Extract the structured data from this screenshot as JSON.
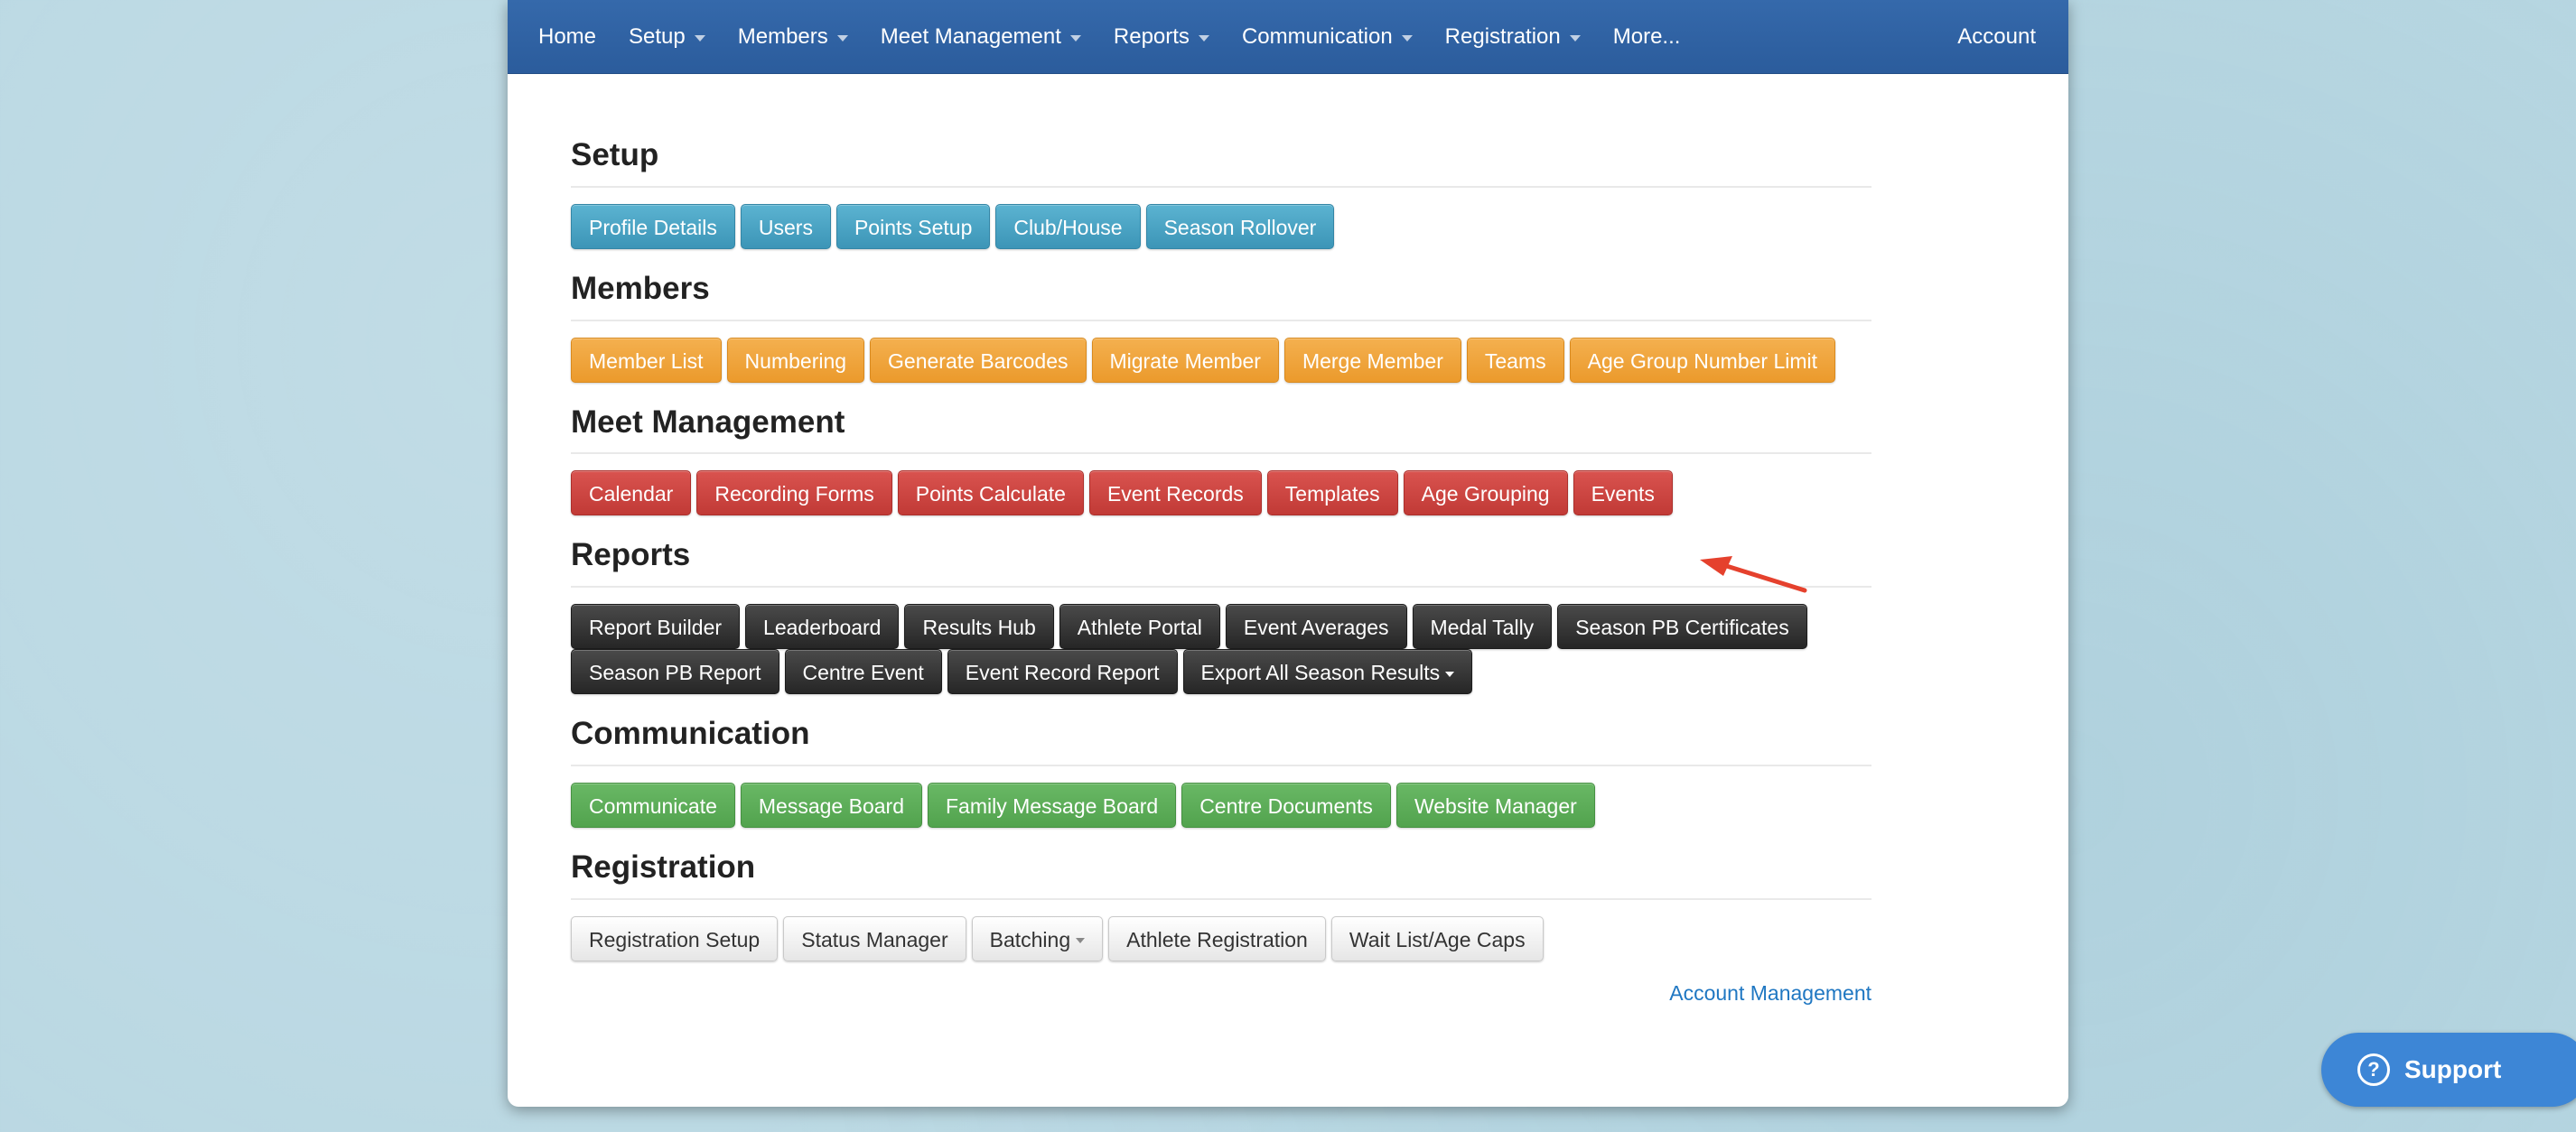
{
  "nav": {
    "items": [
      {
        "label": "Home",
        "dropdown": false
      },
      {
        "label": "Setup",
        "dropdown": true
      },
      {
        "label": "Members",
        "dropdown": true
      },
      {
        "label": "Meet Management",
        "dropdown": true
      },
      {
        "label": "Reports",
        "dropdown": true
      },
      {
        "label": "Communication",
        "dropdown": true
      },
      {
        "label": "Registration",
        "dropdown": true
      },
      {
        "label": "More...",
        "dropdown": false
      }
    ],
    "account": "Account"
  },
  "sections": {
    "setup": {
      "title": "Setup",
      "buttons": [
        "Profile Details",
        "Users",
        "Points Setup",
        "Club/House",
        "Season Rollover"
      ]
    },
    "members": {
      "title": "Members",
      "buttons": [
        "Member List",
        "Numbering",
        "Generate Barcodes",
        "Migrate Member",
        "Merge Member",
        "Teams",
        "Age Group Number Limit"
      ]
    },
    "meet": {
      "title": "Meet Management",
      "buttons": [
        "Calendar",
        "Recording Forms",
        "Points Calculate",
        "Event Records",
        "Templates",
        "Age Grouping",
        "Events"
      ]
    },
    "reports": {
      "title": "Reports",
      "row1": [
        "Report Builder",
        "Leaderboard",
        "Results Hub",
        "Athlete Portal",
        "Event Averages",
        "Medal Tally",
        "Season PB Certificates"
      ],
      "row2": [
        "Season PB Report",
        "Centre Event",
        "Event Record Report",
        "Export All Season Results"
      ]
    },
    "communication": {
      "title": "Communication",
      "buttons": [
        "Communicate",
        "Message Board",
        "Family Message Board",
        "Centre Documents",
        "Website Manager"
      ]
    },
    "registration": {
      "title": "Registration",
      "buttons": [
        "Registration Setup",
        "Status Manager",
        "Batching",
        "Athlete Registration",
        "Wait List/Age Caps"
      ]
    }
  },
  "account_management": "Account Management",
  "support": "Support",
  "colors": {
    "nav": "#2f63a5",
    "setup": "#4aa3c4",
    "members": "#f0a43e",
    "meet": "#cd4743",
    "reports": "#333333",
    "communication": "#5cad58",
    "registration": "#f0f0f0",
    "arrow": "#e5412d",
    "support": "#3d86d6"
  }
}
